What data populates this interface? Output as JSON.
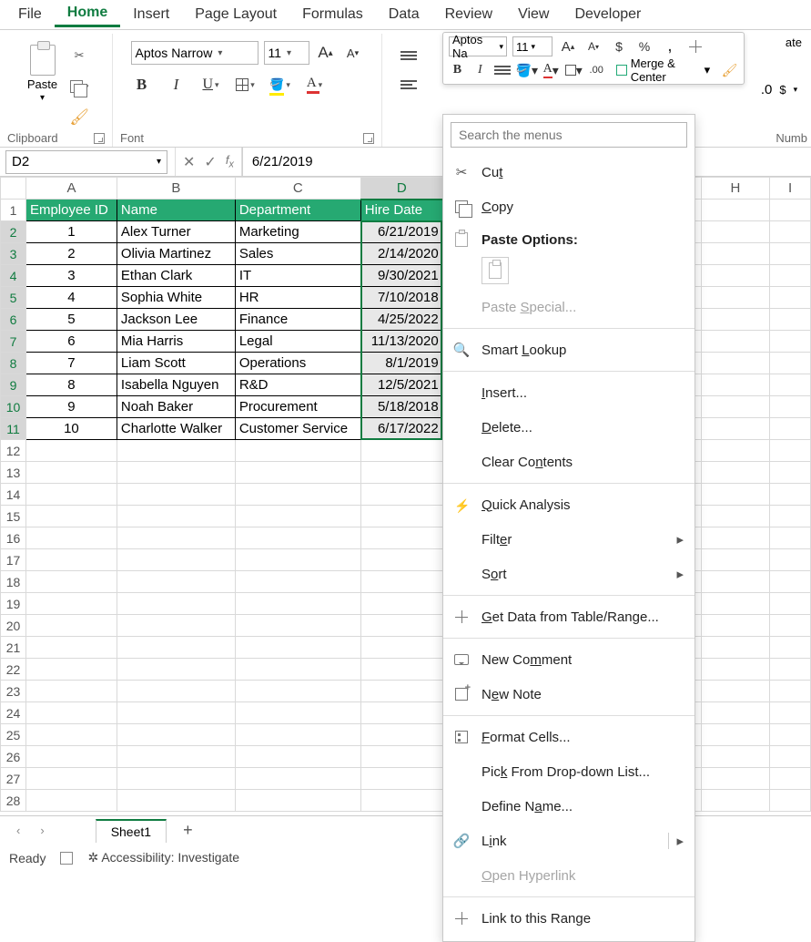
{
  "ribbon": {
    "tabs": [
      "File",
      "Home",
      "Insert",
      "Page Layout",
      "Formulas",
      "Data",
      "Review",
      "View",
      "Developer"
    ],
    "active_tab": "Home",
    "clipboard": {
      "label": "Clipboard",
      "paste": "Paste"
    },
    "font": {
      "label": "Font",
      "name": "Aptos Narrow",
      "size": "11",
      "bold": "B",
      "italic": "I",
      "underline": "U"
    },
    "number": {
      "label": "Numb"
    }
  },
  "mini": {
    "font": "Aptos Na",
    "size": "11",
    "merge": "Merge & Center",
    "ate": "ate"
  },
  "namebox": "D2",
  "formula_value": "6/21/2019",
  "columns": {
    "A": "A",
    "B": "B",
    "C": "C",
    "D": "D",
    "H": "H",
    "I": "I"
  },
  "headers": {
    "A": "Employee ID",
    "B": "Name",
    "C": "Department",
    "D": "Hire Date"
  },
  "rows": [
    {
      "id": "1",
      "name": "Alex Turner",
      "dept": "Marketing",
      "date": "6/21/2019"
    },
    {
      "id": "2",
      "name": "Olivia Martinez",
      "dept": "Sales",
      "date": "2/14/2020"
    },
    {
      "id": "3",
      "name": "Ethan Clark",
      "dept": "IT",
      "date": "9/30/2021"
    },
    {
      "id": "4",
      "name": "Sophia White",
      "dept": "HR",
      "date": "7/10/2018"
    },
    {
      "id": "5",
      "name": "Jackson Lee",
      "dept": "Finance",
      "date": "4/25/2022"
    },
    {
      "id": "6",
      "name": "Mia Harris",
      "dept": "Legal",
      "date": "11/13/2020"
    },
    {
      "id": "7",
      "name": "Liam Scott",
      "dept": "Operations",
      "date": "8/1/2019"
    },
    {
      "id": "8",
      "name": "Isabella Nguyen",
      "dept": "R&D",
      "date": "12/5/2021"
    },
    {
      "id": "9",
      "name": "Noah Baker",
      "dept": "Procurement",
      "date": "5/18/2018"
    },
    {
      "id": "10",
      "name": "Charlotte Walker",
      "dept": "Customer Service",
      "date": "6/17/2022"
    }
  ],
  "sheet_tab": "Sheet1",
  "status": {
    "ready": "Ready",
    "acc": "Accessibility: Investigate"
  },
  "context": {
    "search_ph": "Search the menus",
    "cut": "Cut",
    "copy": "Copy",
    "paste_opt": "Paste Options:",
    "paste_special": "Paste Special...",
    "smart": "Smart Lookup",
    "insert": "Insert...",
    "delete": "Delete...",
    "clear": "Clear Contents",
    "quick": "Quick Analysis",
    "filter": "Filter",
    "sort": "Sort",
    "getdata": "Get Data from Table/Range...",
    "comment": "New Comment",
    "note": "New Note",
    "format": "Format Cells...",
    "pick": "Pick From Drop-down List...",
    "define": "Define Name...",
    "link": "Link",
    "open_hyper": "Open Hyperlink",
    "linkrange": "Link to this Range"
  }
}
